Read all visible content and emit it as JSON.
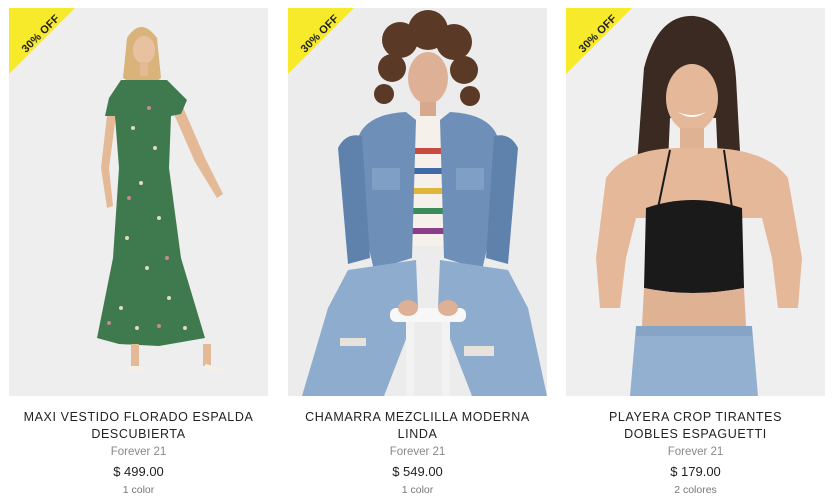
{
  "products": [
    {
      "badge": "30% OFF",
      "name": "MAXI VESTIDO FLORADO ESPALDA DESCUBIERTA",
      "brand": "Forever 21",
      "price": "$ 499.00",
      "colors": "1 color",
      "image": "model-green-floral-maxi-dress"
    },
    {
      "badge": "30% OFF",
      "name": "CHAMARRA MEZCLILLA MODERNA LINDA",
      "brand": "Forever 21",
      "price": "$ 549.00",
      "colors": "1 color",
      "image": "model-denim-jacket-ripped-jeans"
    },
    {
      "badge": "30% OFF",
      "name": "PLAYERA CROP TIRANTES DOBLES ESPAGUETTI",
      "brand": "Forever 21",
      "price": "$ 179.00",
      "colors": "2 colores",
      "image": "model-black-crop-top"
    }
  ],
  "colors": {
    "badge": "#f7ea2a",
    "background": "#ffffff",
    "photo_background": "#efefef"
  }
}
